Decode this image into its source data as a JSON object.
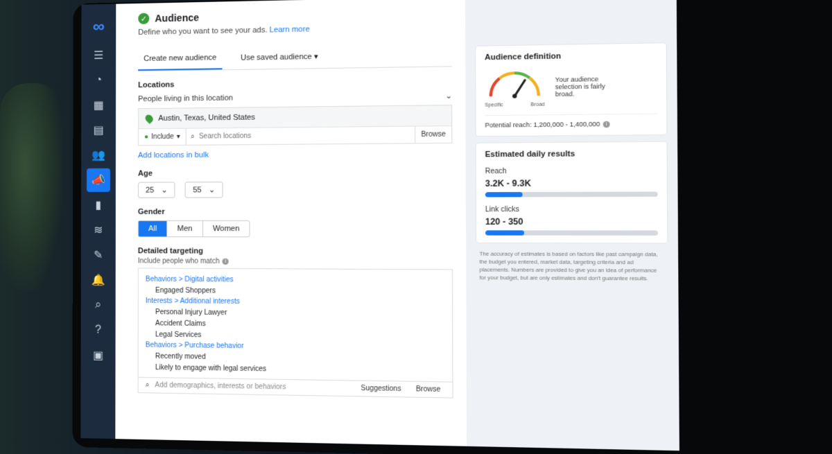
{
  "audience": {
    "title": "Audience",
    "subtitle": "Define who you want to see your ads.",
    "learn_more": "Learn more",
    "tabs": [
      {
        "label": "Create new audience",
        "active": true
      },
      {
        "label": "Use saved audience",
        "active": false
      }
    ]
  },
  "locations": {
    "label": "Locations",
    "sublabel": "People living in this location",
    "selected": "Austin, Texas, United States",
    "include_label": "Include",
    "search_placeholder": "Search locations",
    "browse_label": "Browse",
    "add_bulk": "Add locations in bulk"
  },
  "age": {
    "label": "Age",
    "min": "25",
    "max": "55"
  },
  "gender": {
    "label": "Gender",
    "options": [
      "All",
      "Men",
      "Women"
    ],
    "selected": "All"
  },
  "detailed_targeting": {
    "label": "Detailed targeting",
    "sublabel": "Include people who match",
    "groups": [
      {
        "category": "Behaviors > Digital activities",
        "items": [
          "Engaged Shoppers"
        ]
      },
      {
        "category": "Interests > Additional interests",
        "items": [
          "Personal Injury Lawyer",
          "Accident Claims",
          "Legal Services"
        ]
      },
      {
        "category": "Behaviors > Purchase behavior",
        "items": [
          "Recently moved",
          "Likely to engage with legal services"
        ]
      }
    ],
    "search_placeholder": "Add demographics, interests or behaviors",
    "suggestions_label": "Suggestions",
    "browse_label": "Browse"
  },
  "audience_definition": {
    "title": "Audience definition",
    "description": "Your audience selection is fairly broad.",
    "gauge_left": "Specific",
    "gauge_right": "Broad",
    "gauge_level": 0.68,
    "potential_reach": "Potential reach: 1,200,000 - 1,400,000"
  },
  "estimated": {
    "title": "Estimated daily results",
    "reach_label": "Reach",
    "reach_value": "3.2K - 9.3K",
    "reach_fill": 0.22,
    "clicks_label": "Link clicks",
    "clicks_value": "120 - 350",
    "clicks_fill": 0.23
  },
  "disclaimer": "The accuracy of estimates is based on factors like past campaign data, the budget you entered, market data, targeting criteria and ad placements. Numbers are provided to give you an idea of performance for your budget, but are only estimates and don't guarantee results.",
  "colors": {
    "accent": "#1877f2",
    "sidebar": "#1c2b3d",
    "success": "#3a9b3a"
  },
  "sidebar_icons": [
    "meta-logo-icon",
    "menu-icon",
    "dashboard-icon",
    "table-icon",
    "document-icon",
    "audience-icon",
    "megaphone-icon",
    "chart-icon",
    "database-icon",
    "tools-icon",
    "bell-icon",
    "search-icon",
    "help-icon",
    "panel-icon"
  ]
}
